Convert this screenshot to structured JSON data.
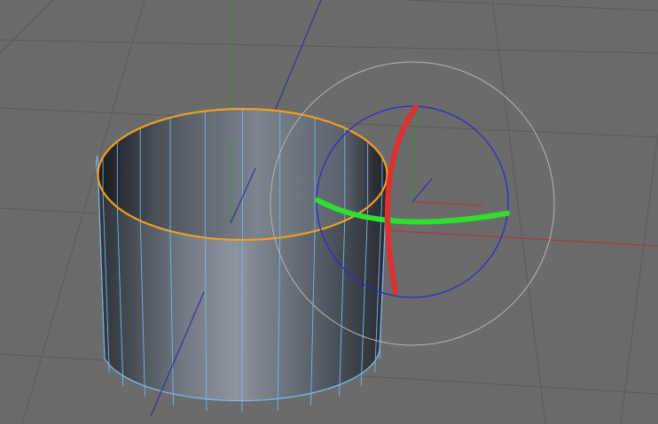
{
  "viewport": {
    "projection": "perspective",
    "background_color": "#6b6b6b",
    "grid_color": "#5a5a5a"
  },
  "world_axes": {
    "x_color": "#c03030",
    "y_color": "#2f9a2f",
    "z_color": "#2a2aa0"
  },
  "object": {
    "type": "cylinder",
    "selected": true,
    "highlight_color": "#f0a020",
    "wire_color": "#7ab4e8"
  },
  "rotate_gizmo": {
    "active": true,
    "bank_ring_color": "#e03030",
    "heading_ring_color": "#2fe02f",
    "pitch_ring_color": "#2828d0",
    "outer_ring_color": "#b4b4b4"
  }
}
